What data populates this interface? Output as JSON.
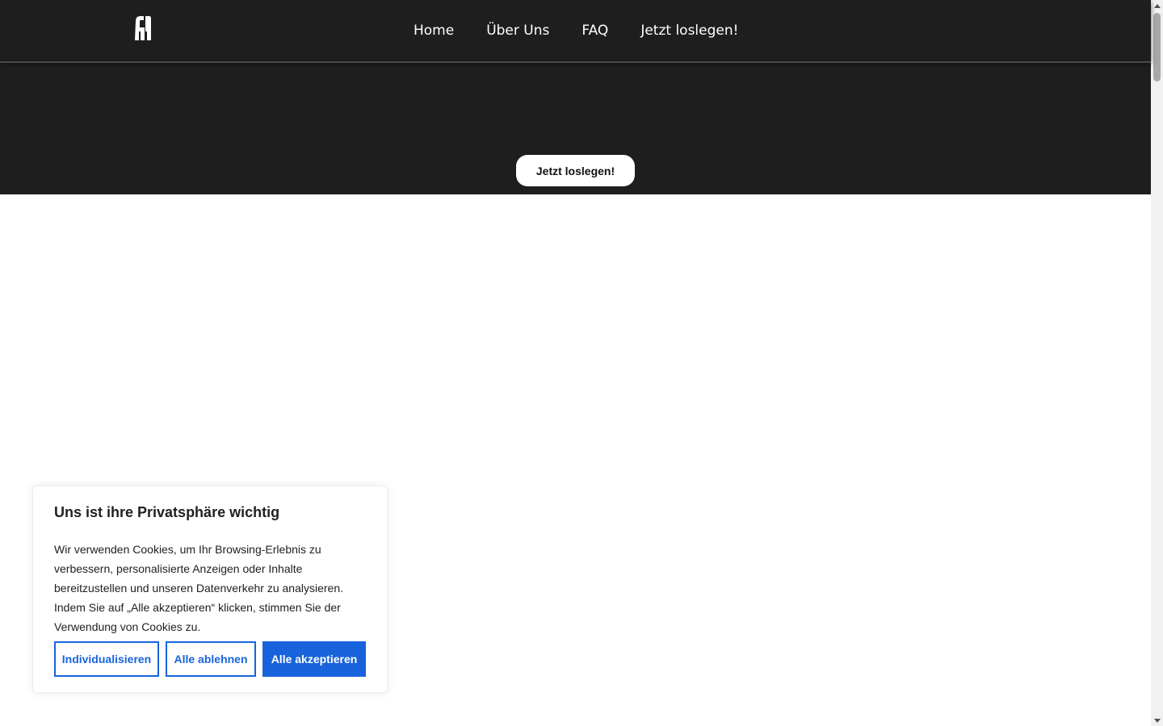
{
  "nav": {
    "logo_icon": "abstract-a-logo-icon",
    "links": [
      {
        "label": "Home"
      },
      {
        "label": "Über Uns"
      },
      {
        "label": "FAQ"
      },
      {
        "label": "Jetzt loslegen!"
      }
    ]
  },
  "hero": {
    "cta_label": "Jetzt loslegen!"
  },
  "cookie_banner": {
    "title": "Uns ist ihre Privatsphäre wichtig",
    "text": "Wir verwenden Cookies, um Ihr Browsing-Erlebnis zu verbessern, personalisierte Anzeigen oder Inhalte bereitzustellen und unseren Datenverkehr zu analysieren. Indem Sie auf „Alle akzeptieren“ klicken, stimmen Sie der Verwendung von Cookies zu.",
    "customize_label": "Individualisieren",
    "reject_label": "Alle ablehnen",
    "accept_label": "Alle akzeptieren"
  },
  "colors": {
    "header_bg": "#1e1e1e",
    "accent": "#1863dc",
    "text_dark": "#212121"
  }
}
